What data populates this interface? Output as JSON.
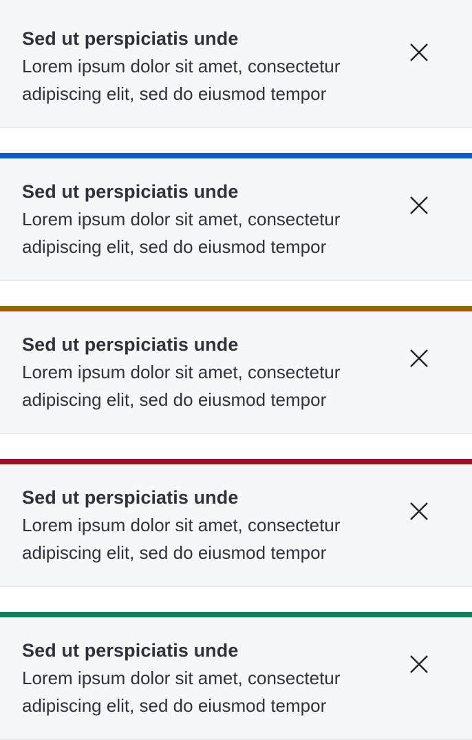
{
  "notifications": [
    {
      "title": "Sed ut perspiciatis unde",
      "message": "Lorem ipsum dolor sit amet, consectetur adipiscing elit, sed do eiusmod tempor",
      "accent_color": "",
      "close_icon": "close-icon"
    },
    {
      "title": "Sed ut perspiciatis unde",
      "message": "Lorem ipsum dolor sit amet, consectetur adipiscing elit, sed do eiusmod tempor",
      "accent_color": "#0b5bd3",
      "close_icon": "close-icon"
    },
    {
      "title": "Sed ut perspiciatis unde",
      "message": "Lorem ipsum dolor sit amet, consectetur adipiscing elit, sed do eiusmod tempor",
      "accent_color": "#946200",
      "close_icon": "close-icon"
    },
    {
      "title": "Sed ut perspiciatis unde",
      "message": "Lorem ipsum dolor sit amet, consectetur adipiscing elit, sed do eiusmod tempor",
      "accent_color": "#9b1229",
      "close_icon": "close-icon"
    },
    {
      "title": "Sed ut perspiciatis unde",
      "message": "Lorem ipsum dolor sit amet, consectetur adipiscing elit, sed do eiusmod tempor",
      "accent_color": "#117f5c",
      "close_icon": "close-icon"
    }
  ]
}
